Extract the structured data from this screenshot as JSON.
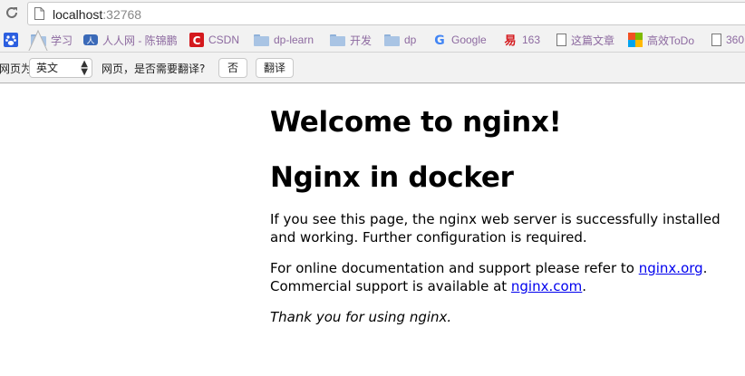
{
  "browser": {
    "url_host": "localhost",
    "url_port": ":32768",
    "reload_icon": "reload-icon",
    "page_icon": "page-icon"
  },
  "bookmarks": [
    {
      "label": "",
      "icon": "baidu-icon"
    },
    {
      "label": "学习",
      "icon": "folder-icon"
    },
    {
      "label": "人人网 - 陈锦鹏",
      "icon": "renren-icon"
    },
    {
      "label": "CSDN",
      "icon": "csdn-icon"
    },
    {
      "label": "dp-learn",
      "icon": "folder-icon"
    },
    {
      "label": "开发",
      "icon": "folder-icon"
    },
    {
      "label": "dp",
      "icon": "folder-icon"
    },
    {
      "label": "Google",
      "icon": "google-icon"
    },
    {
      "label": "163",
      "icon": "163-icon"
    },
    {
      "label": "这篇文章",
      "icon": "document-icon"
    },
    {
      "label": "高效ToDo",
      "icon": "todo-icon"
    },
    {
      "label": "360",
      "icon": "document-icon"
    }
  ],
  "translate_bar": {
    "prefix": "网页为",
    "language": "英文",
    "question": "网页，是否需要翻译?",
    "no_label": "否",
    "translate_label": "翻译"
  },
  "page": {
    "heading1": "Welcome to nginx!",
    "heading2": "Nginx in docker",
    "para1": "If you see this page, the nginx web server is successfully installed and working. Further configuration is required.",
    "para2_prefix": "For online documentation and support please refer to ",
    "link1": "nginx.org",
    "para2_mid": ".",
    "para2_line2": "Commercial support is available at ",
    "link2": "nginx.com",
    "para2_end": ".",
    "para3": "Thank you for using nginx."
  },
  "colors": {
    "link": "#0000ee",
    "bookmark_text": "#8d6aa0",
    "chrome_bg": "#f2f2f2"
  }
}
